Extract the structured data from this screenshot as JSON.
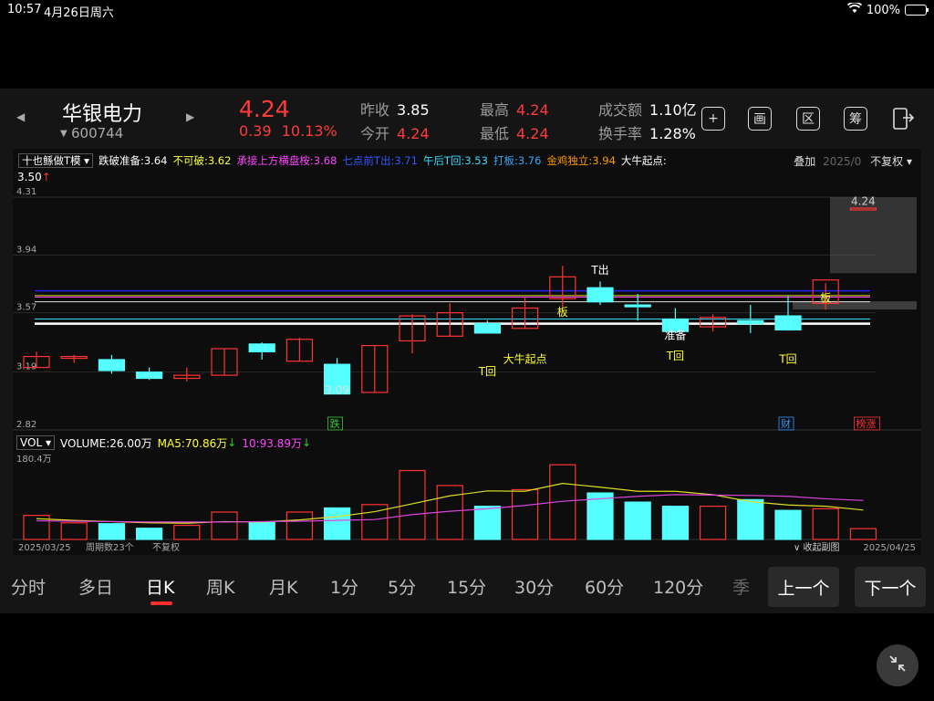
{
  "status": {
    "time": "10:57",
    "date": "4月26日周六",
    "battery_text": "100%"
  },
  "header": {
    "name": "华银电力",
    "code": "600744",
    "price": "4.24",
    "change": "0.39",
    "change_pct": "10.13%",
    "stats": [
      {
        "label": "昨收",
        "value": "3.85",
        "red": false
      },
      {
        "label": "今开",
        "value": "4.24",
        "red": true
      },
      {
        "label": "最高",
        "value": "4.24",
        "red": true
      },
      {
        "label": "最低",
        "value": "4.24",
        "red": true
      },
      {
        "label": "成交额",
        "value": "1.10亿",
        "red": false
      },
      {
        "label": "换手率",
        "value": "1.28%",
        "red": false
      }
    ],
    "icons": [
      {
        "name": "add-watchlist-icon",
        "glyph": "+"
      },
      {
        "name": "draw-icon",
        "glyph": "画"
      },
      {
        "name": "range-icon",
        "glyph": "区"
      },
      {
        "name": "chips-icon",
        "glyph": "筹"
      }
    ]
  },
  "indicator_bar": {
    "selector": "十也鲧做T模",
    "items": [
      {
        "text": "跌破准备:3.64",
        "color": "#ffffff"
      },
      {
        "text": "不可破:3.62",
        "color": "#ffff33"
      },
      {
        "text": "承接上方横盘桉:3.68",
        "color": "#ff44ff"
      },
      {
        "text": "七点前T出:3.71",
        "color": "#3355ff"
      },
      {
        "text": "午后T回:3.53",
        "color": "#33ddff"
      },
      {
        "text": "打板:3.76",
        "color": "#33aaff"
      },
      {
        "text": "金鸡独立:3.94",
        "color": "#ff9900"
      },
      {
        "text": "大牛起点:",
        "color": "#ffffff"
      }
    ],
    "overlay": "叠加",
    "date_partial": "2025/0",
    "adjust": "不复权",
    "extra_value": "3.50"
  },
  "chart_data": {
    "type": "candlestick",
    "x_start_label": "2025/03/25",
    "x_end_label": "2025/04/25",
    "period_count_label": "周期数23个",
    "adjust_label": "不复权",
    "y_ticks": [
      "4.31",
      "3.94",
      "3.57",
      "3.19",
      "2.82"
    ],
    "ylim": [
      2.82,
      4.31
    ],
    "candles": [
      {
        "o": 3.22,
        "h": 3.32,
        "l": 3.22,
        "c": 3.29
      },
      {
        "o": 3.28,
        "h": 3.3,
        "l": 3.25,
        "c": 3.29
      },
      {
        "o": 3.27,
        "h": 3.3,
        "l": 3.18,
        "c": 3.2
      },
      {
        "o": 3.19,
        "h": 3.22,
        "l": 3.14,
        "c": 3.15
      },
      {
        "o": 3.15,
        "h": 3.22,
        "l": 3.13,
        "c": 3.17
      },
      {
        "o": 3.17,
        "h": 3.34,
        "l": 3.17,
        "c": 3.34
      },
      {
        "o": 3.37,
        "h": 3.38,
        "l": 3.27,
        "c": 3.32
      },
      {
        "o": 3.26,
        "h": 3.41,
        "l": 3.26,
        "c": 3.4
      },
      {
        "o": 3.24,
        "h": 3.28,
        "l": 3.05,
        "c": 3.05
      },
      {
        "o": 3.06,
        "h": 3.36,
        "l": 3.06,
        "c": 3.36
      },
      {
        "o": 3.39,
        "h": 3.56,
        "l": 3.31,
        "c": 3.55
      },
      {
        "o": 3.42,
        "h": 3.63,
        "l": 3.42,
        "c": 3.57
      },
      {
        "o": 3.5,
        "h": 3.52,
        "l": 3.44,
        "c": 3.44
      },
      {
        "o": 3.47,
        "h": 3.67,
        "l": 3.47,
        "c": 3.6
      },
      {
        "o": 3.66,
        "h": 3.87,
        "l": 3.6,
        "c": 3.8
      },
      {
        "o": 3.73,
        "h": 3.77,
        "l": 3.62,
        "c": 3.64
      },
      {
        "o": 3.62,
        "h": 3.69,
        "l": 3.52,
        "c": 3.61
      },
      {
        "o": 3.53,
        "h": 3.6,
        "l": 3.44,
        "c": 3.45
      },
      {
        "o": 3.48,
        "h": 3.56,
        "l": 3.45,
        "c": 3.54
      },
      {
        "o": 3.52,
        "h": 3.62,
        "l": 3.44,
        "c": 3.5
      },
      {
        "o": 3.55,
        "h": 3.68,
        "l": 3.47,
        "c": 3.46
      },
      {
        "o": 3.63,
        "h": 3.76,
        "l": 3.59,
        "c": 3.78
      },
      {
        "o": 4.24,
        "h": 4.24,
        "l": 4.24,
        "c": 4.24
      }
    ],
    "h_lines": [
      {
        "y": 3.71,
        "color": "#2222ee",
        "width": 1.5
      },
      {
        "y": 3.68,
        "color": "#dddd22",
        "width": 1
      },
      {
        "y": 3.67,
        "color": "#ff44ff",
        "width": 1
      },
      {
        "y": 3.53,
        "color": "#33ddff",
        "width": 1
      },
      {
        "y": 3.64,
        "color": "#dddddd",
        "width": 1
      },
      {
        "y": 3.5,
        "color": "#ffffff",
        "width": 2.5
      }
    ],
    "annotations": [
      {
        "text": "3.09",
        "i": 8,
        "y": 3.05,
        "color": "#dddddd"
      },
      {
        "text": "T回",
        "i": 12,
        "y": 3.17,
        "color": "#ffff33"
      },
      {
        "text": "大牛起点",
        "i": 13,
        "y": 3.25,
        "color": "#ffff33"
      },
      {
        "text": "板",
        "i": 14,
        "y": 3.55,
        "color": "#ffff33"
      },
      {
        "text": "T出",
        "i": 15,
        "y": 3.82,
        "color": "#ffffff"
      },
      {
        "text": "准备",
        "i": 17,
        "y": 3.4,
        "color": "#ffffff"
      },
      {
        "text": "T回",
        "i": 17,
        "y": 3.27,
        "color": "#ffff33"
      },
      {
        "text": "T回",
        "i": 20,
        "y": 3.25,
        "color": "#ffff33"
      },
      {
        "text": "板",
        "i": 21,
        "y": 3.64,
        "color": "#ffff33"
      },
      {
        "text": "4.24",
        "i": 22,
        "y": 4.26,
        "color": "#cccccc"
      }
    ],
    "markers": [
      {
        "text": "跌",
        "i": 8,
        "color": "#33cc33"
      },
      {
        "text": "财",
        "i": 20,
        "color": "#3399ff"
      },
      {
        "text": "榜涨",
        "i": 22,
        "color": "#ff3333"
      }
    ],
    "volume": {
      "selector": "VOL",
      "label": "VOLUME:26.00万",
      "ma5_label": "MA5:70.86万",
      "ma10_label": "10:93.89万",
      "y_top_label": "180.4万",
      "collapse_label": "收起副图",
      "max": 180.4,
      "values": [
        58,
        40,
        38,
        27,
        34,
        66,
        42,
        66,
        76,
        84,
        166,
        130,
        80,
        120,
        180,
        112,
        90,
        80,
        80,
        96,
        70,
        74,
        26
      ],
      "ma5": [
        50,
        46,
        43,
        40,
        39,
        43,
        42,
        47,
        55,
        67,
        86,
        105,
        117,
        116,
        135,
        126,
        116,
        116,
        108,
        91,
        83,
        80,
        70.86
      ],
      "ma10": [
        45,
        44,
        43,
        42,
        42,
        42,
        43,
        44,
        46,
        48,
        60,
        68,
        74,
        82,
        92,
        98,
        104,
        108,
        107,
        106,
        104,
        98,
        93.89
      ]
    }
  },
  "timeframes": [
    {
      "label": "分时",
      "active": false
    },
    {
      "label": "多日",
      "active": false
    },
    {
      "label": "日K",
      "active": true
    },
    {
      "label": "周K",
      "active": false
    },
    {
      "label": "月K",
      "active": false
    },
    {
      "label": "1分",
      "active": false
    },
    {
      "label": "5分",
      "active": false
    },
    {
      "label": "15分",
      "active": false
    },
    {
      "label": "30分",
      "active": false
    },
    {
      "label": "60分",
      "active": false
    },
    {
      "label": "120分",
      "active": false
    },
    {
      "label": "季",
      "active": false
    }
  ],
  "nav": {
    "prev": "上一个",
    "next": "下一个"
  },
  "colors": {
    "up": "#ff3333",
    "down": "#55ffff",
    "accent": "#ff2d2d"
  }
}
